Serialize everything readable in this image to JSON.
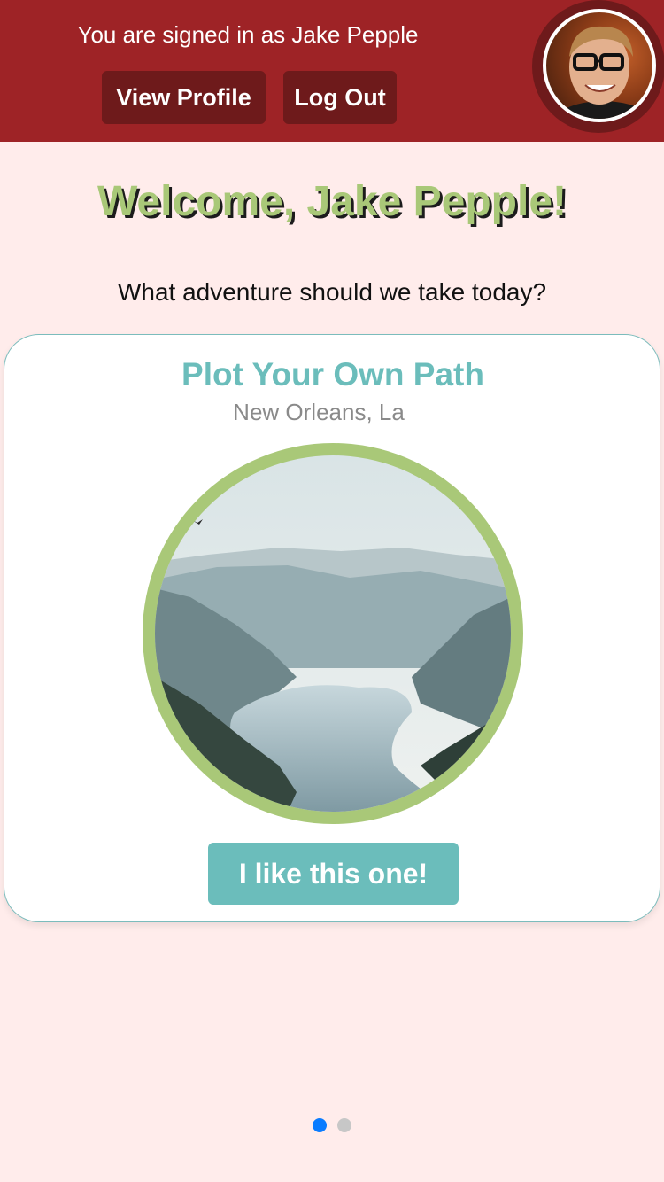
{
  "header": {
    "signed_in_text": "You are signed in as Jake Pepple",
    "view_profile_label": "View Profile",
    "log_out_label": "Log Out"
  },
  "main": {
    "welcome": "Welcome, Jake Pepple!",
    "question": "What adventure should we take today?"
  },
  "card": {
    "title": "Plot Your Own Path",
    "location": "New Orleans, La",
    "like_label": "I like this one!"
  },
  "pagination": {
    "current_page": 1,
    "total_pages": 2
  },
  "colors": {
    "header_bg": "#9e2326",
    "button_dark": "#6e1a1b",
    "page_bg": "#ffeceb",
    "accent_green": "#a9c878",
    "accent_teal": "#6bbdbb",
    "active_dot": "#0a7cff"
  }
}
